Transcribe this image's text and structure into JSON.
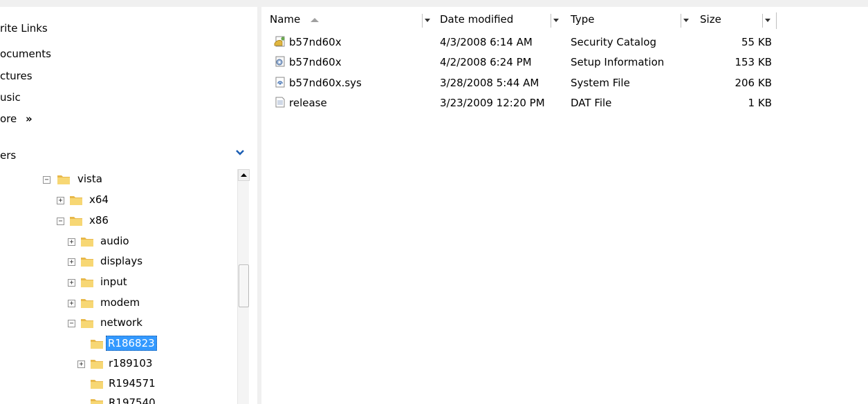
{
  "favorites": {
    "items": [
      {
        "label": "rite Links"
      },
      {
        "label": "ocuments"
      },
      {
        "label": "ctures"
      },
      {
        "label": "usic"
      },
      {
        "label": "ore",
        "arrow": "»"
      }
    ]
  },
  "folders": {
    "header": "ers",
    "tree": [
      {
        "label": "vista",
        "expander": "−"
      },
      {
        "label": "x64",
        "expander": "+"
      },
      {
        "label": "x86",
        "expander": "−"
      },
      {
        "label": "audio",
        "expander": "+"
      },
      {
        "label": "displays",
        "expander": "+"
      },
      {
        "label": "input",
        "expander": "+"
      },
      {
        "label": "modem",
        "expander": "+"
      },
      {
        "label": "network",
        "expander": "−"
      },
      {
        "label": "R186823",
        "expander": "",
        "selected": true
      },
      {
        "label": "r189103",
        "expander": "+"
      },
      {
        "label": "R194571",
        "expander": ""
      },
      {
        "label": "R197540",
        "expander": ""
      }
    ]
  },
  "file_list": {
    "columns": {
      "name": "Name",
      "date": "Date modified",
      "type": "Type",
      "size": "Size"
    },
    "rows": [
      {
        "icon": "security-catalog-icon",
        "name": "b57nd60x",
        "date": "4/3/2008 6:14 AM",
        "type": "Security Catalog",
        "size": "55 KB"
      },
      {
        "icon": "setup-information-icon",
        "name": "b57nd60x",
        "date": "4/2/2008 6:24 PM",
        "type": "Setup Information",
        "size": "153 KB"
      },
      {
        "icon": "system-file-icon",
        "name": "b57nd60x.sys",
        "date": "3/28/2008 5:44 AM",
        "type": "System File",
        "size": "206 KB"
      },
      {
        "icon": "dat-file-icon",
        "name": "release",
        "date": "3/23/2009 12:20 PM",
        "type": "DAT File",
        "size": "1 KB"
      }
    ]
  },
  "colors": {
    "selection": "#3399ff",
    "folder": "#f2c94c"
  }
}
